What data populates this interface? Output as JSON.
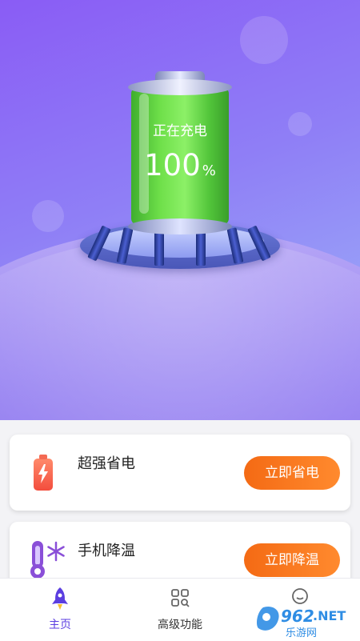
{
  "charging": {
    "status": "正在充电",
    "level": "100",
    "unit": "%"
  },
  "features": [
    {
      "title": "超强省电",
      "button": "立即省电",
      "icon": "battery-bolt-icon"
    },
    {
      "title": "手机降温",
      "button": "立即降温",
      "icon": "thermometer-snowflake-icon"
    }
  ],
  "tabs": [
    {
      "label": "主页",
      "icon": "rocket-icon",
      "active": true
    },
    {
      "label": "高级功能",
      "icon": "grid-search-icon",
      "active": false
    },
    {
      "label": "",
      "icon": "user-icon",
      "active": false
    }
  ],
  "watermark": "962.NET 乐游网",
  "colors": {
    "accent": "#5b3ee0",
    "button": "#f46a14",
    "battery": "#6fe04a"
  }
}
